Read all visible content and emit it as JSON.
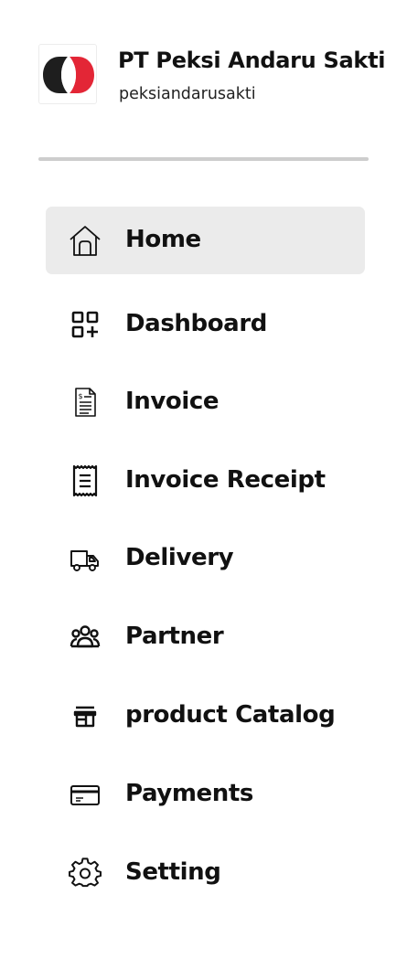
{
  "profile": {
    "name": "PT Peksi Andaru Sakti",
    "handle": "peksiandarusakti",
    "logo_icon": "company-logo",
    "colors": {
      "dark": "#1e1e1e",
      "red": "#e32636"
    }
  },
  "nav": {
    "active": "home",
    "items": [
      {
        "id": "home",
        "label": "Home",
        "icon": "home-icon"
      },
      {
        "id": "dashboard",
        "label": "Dashboard",
        "icon": "dashboard-icon"
      },
      {
        "id": "invoice",
        "label": "Invoice",
        "icon": "invoice-icon"
      },
      {
        "id": "invoice-receipt",
        "label": "Invoice Receipt",
        "icon": "receipt-icon"
      },
      {
        "id": "delivery",
        "label": "Delivery",
        "icon": "truck-icon"
      },
      {
        "id": "partner",
        "label": "Partner",
        "icon": "people-icon"
      },
      {
        "id": "product-catalog",
        "label": "product Catalog",
        "icon": "store-icon"
      },
      {
        "id": "payments",
        "label": "Payments",
        "icon": "credit-card-icon"
      },
      {
        "id": "setting",
        "label": "Setting",
        "icon": "gear-icon"
      }
    ]
  },
  "colors": {
    "active_bg": "#ebebeb",
    "text": "#111111",
    "divider": "#cdcdcd"
  }
}
